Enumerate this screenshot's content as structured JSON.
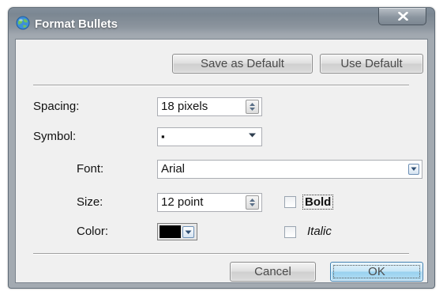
{
  "window": {
    "title": "Format Bullets",
    "title_icon": "app-globe-icon",
    "close_icon": "close-x-icon"
  },
  "top_buttons": {
    "save_default_label": "Save as Default",
    "use_default_label": "Use Default"
  },
  "spacing": {
    "label": "Spacing:",
    "value": "18 pixels"
  },
  "symbol": {
    "label": "Symbol:",
    "value": "▪"
  },
  "font": {
    "label": "Font:",
    "value": "Arial"
  },
  "size": {
    "label": "Size:",
    "value": "12 point"
  },
  "style": {
    "bold_label": "Bold",
    "bold_checked": false,
    "italic_label": "Italic",
    "italic_checked": false
  },
  "color": {
    "label": "Color:",
    "value_hex": "#000000"
  },
  "bottom_buttons": {
    "cancel_label": "Cancel",
    "ok_label": "OK"
  }
}
